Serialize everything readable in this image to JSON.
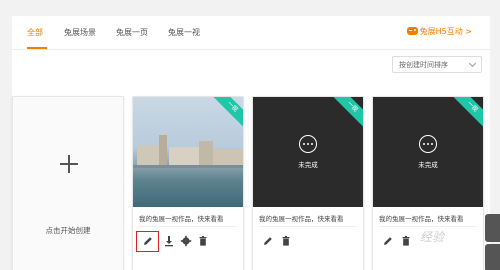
{
  "tabs": [
    {
      "label": "全部",
      "active": true
    },
    {
      "label": "兔展场景",
      "active": false
    },
    {
      "label": "兔展一页",
      "active": false
    },
    {
      "label": "兔展一视",
      "active": false
    }
  ],
  "h5_link": "兔展H5互动 >",
  "sort": {
    "label": "按创建时间排序"
  },
  "create_card": {
    "label": "点击开始创建"
  },
  "works": [
    {
      "title": "我的兔展一视作品，快来看看",
      "corner_badge": "一视",
      "status": "",
      "thumb": "photo"
    },
    {
      "title": "我的兔展一视作品，快来看看",
      "corner_badge": "一视",
      "status": "未完成",
      "thumb": "dark"
    },
    {
      "title": "我的兔展一视作品，快来看看",
      "corner_badge": "一视",
      "status": "未完成",
      "thumb": "dark"
    }
  ],
  "watermark": "经验",
  "colors": {
    "accent": "#f57c00",
    "badge": "#21c6a8",
    "highlight": "#e02020"
  }
}
